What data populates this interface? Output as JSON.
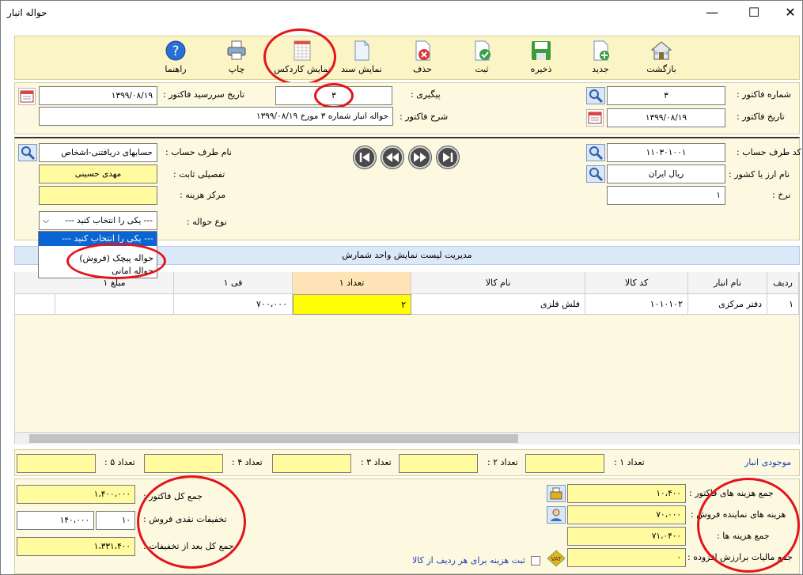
{
  "window": {
    "title": "حواله انبار",
    "minimize": "—",
    "maximize": "☐",
    "close": "✕"
  },
  "toolbar": {
    "back": "بازگشت",
    "new": "جدید",
    "save": "ذخیره",
    "register": "ثبت",
    "delete": "حذف",
    "show_doc": "نمایش سند",
    "show_kardex": "نمایش کاردکس",
    "print": "چاپ",
    "help": "راهنما"
  },
  "header": {
    "invoice_no_label": "شماره فاکتور :",
    "invoice_no": "۳",
    "invoice_date_label": "تاریخ فاکتور :",
    "invoice_date": "۱۳۹۹/۰۸/۱۹",
    "followup_label": "پیگیری :",
    "followup": "۳",
    "desc_label": "شرح فاکتور :",
    "desc": "حواله انبار شماره ۳ مورخ ۱۳۹۹/۰۸/۱۹",
    "due_label": "تاریخ سررسید فاکتور :",
    "due": "۱۳۹۹/۰۸/۱۹"
  },
  "party": {
    "code_label": "کد طرف حساب :",
    "code": "۱۱۰۳۰۱۰۰۱",
    "currency_label": "نام ارز یا کشور :",
    "currency": "ریال ایران",
    "rate_label": "نرخ :",
    "rate": "۱",
    "name_label": "نام طرف حساب :",
    "name": "حسابهای دریافتنی-اشخاص",
    "detail_label": "تفصیلی ثابت :",
    "detail": "مهدی حسینی",
    "cost_center_label": "مرکز هزینه :",
    "cost_center": "",
    "type_label": "نوع حواله :",
    "type_value": "--- یکی را انتخاب کنید ---",
    "type_options": [
      "--- یکی را انتخاب کنید ---",
      "حواله پیچک (فروش)",
      "حواله امانی"
    ]
  },
  "grid": {
    "banner": "مدیریت لیست نمایش واحد شمارش",
    "columns": [
      "ردیف",
      "نام انبار",
      "کد کالا",
      "نام کالا",
      "تعداد ۱",
      "فی ۱",
      "مبلغ ۱"
    ],
    "rows": [
      [
        "۱",
        "دفتر مرکزی",
        "۱۰۱۰۱۰۲",
        "فلش فلزی",
        "۲",
        "۷۰۰،۰۰۰",
        ""
      ]
    ]
  },
  "stock": {
    "label": "موجودی انبار",
    "q1": "تعداد ۱ :",
    "q2": "تعداد ۲ :",
    "q3": "تعداد ۳ :",
    "q4": "تعداد ۴ :",
    "q5": "تعداد ۵ :"
  },
  "costs": {
    "invoice_costs_label": "جمع هزینه های فاکتور :",
    "invoice_costs": "۱۰،۴۰۰",
    "agent_costs_label": "هزینه های نماینده فروش :",
    "agent_costs": "۷۰،۰۰۰",
    "total_costs_label": "جمع هزینه ها :",
    "total_costs": "۷۱،۰۴۰۰",
    "vat_label": "جمع مالیات برارزش افزوده :",
    "vat": "۰",
    "per_row_label": "ثبت هزینه برای هر ردیف از کالا"
  },
  "totals": {
    "invoice_total_label": "جمع کل فاکتور :",
    "invoice_total": "۱،۴۰۰،۰۰۰",
    "discount_label": "تخفیفات نقدی فروش :",
    "discount_pct": "۱۰",
    "discount_amount": "۱۴۰،۰۰۰",
    "after_discount_label": "جمع کل بعد از تخفیفات :",
    "after_discount": "۱،۳۳۱،۴۰۰"
  }
}
